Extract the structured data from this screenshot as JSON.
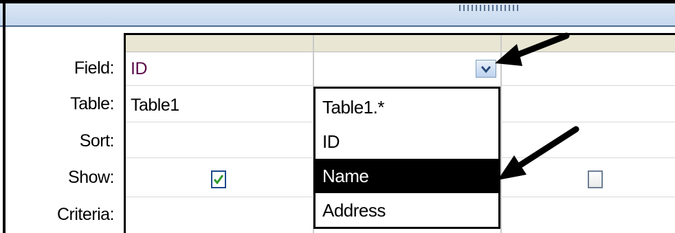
{
  "row_labels": {
    "field": "Field:",
    "table": "Table:",
    "sort": "Sort:",
    "show": "Show:",
    "criteria": "Criteria:"
  },
  "columns": [
    {
      "field": "ID",
      "table": "Table1",
      "sort": "",
      "show": true,
      "criteria": ""
    },
    {
      "field": "",
      "table": "",
      "sort": "",
      "show": null,
      "criteria": ""
    },
    {
      "field": "",
      "table": "",
      "sort": "",
      "show": false,
      "criteria": ""
    }
  ],
  "field_dropdown": {
    "items": [
      "Table1.*",
      "ID",
      "Name",
      "Address"
    ],
    "selected": "Name"
  },
  "icons": {
    "dropdown": "chevron-down-icon",
    "checked": "checkmark-icon",
    "annotation": "arrow-icon"
  },
  "colors": {
    "header_band": "#d9e6f5",
    "grid_header": "#e9e6d3",
    "selected_bg": "#000000",
    "check_green": "#2e9a2e"
  }
}
